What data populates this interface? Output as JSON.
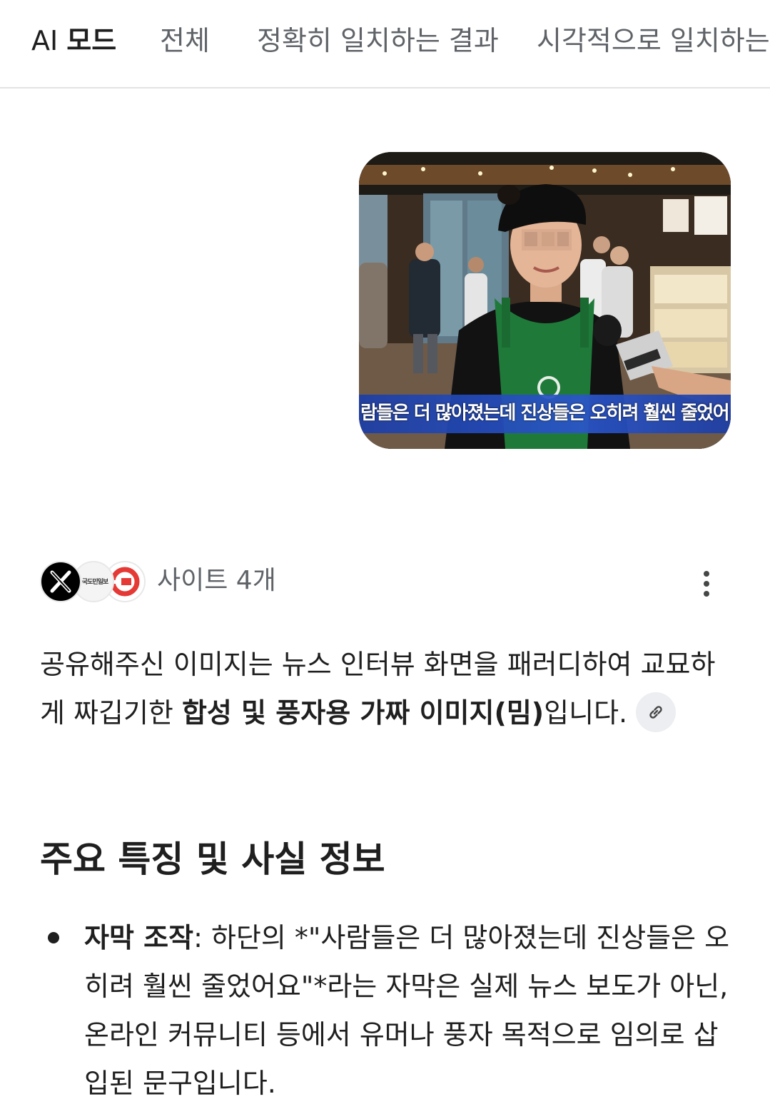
{
  "tabs": [
    {
      "label_prefix": "AI",
      "label_bold": "모드",
      "active": true
    },
    {
      "label": "전체",
      "active": false
    },
    {
      "label": "정확히 일치하는 결과",
      "active": false
    },
    {
      "label": "시각적으로 일치하는 결과",
      "active": false
    }
  ],
  "shared_image": {
    "subtitle": "람들은 더 많아졌는데 진상들은 오히려 훨씬 줄었어"
  },
  "sources": {
    "label": "사이트 4개",
    "icons": [
      "x-logo-icon",
      "newspaper-logo-icon",
      "red-circle-logo-icon"
    ],
    "news_logo_text": "국도민일보"
  },
  "answer": {
    "text_before": "공유해주신 이미지는 뉴스 인터뷰 화면을 패러디하여 교묘하게 짜깁기한 ",
    "text_bold": "합성 및 풍자용 가짜 이미지(밈)",
    "text_after": "입니다."
  },
  "section": {
    "heading": "주요 특징 및 사실 정보",
    "bullets": [
      {
        "title": "자막 조작",
        "body": ": 하단의 *\"사람들은 더 많아졌는데 진상들은 오히려 훨씬 줄었어요\"*라는 자막은 실제 뉴스 보도가 아닌, 온라인 커뮤니티 등에서 유머나 풍자 목적으로 임의로 삽입된 문구입니다."
      }
    ]
  },
  "colors": {
    "text": "#1f1f1f",
    "muted": "#5f6368",
    "subtitle_band": "#2a55c9",
    "apron_green": "#1f7a3a"
  }
}
